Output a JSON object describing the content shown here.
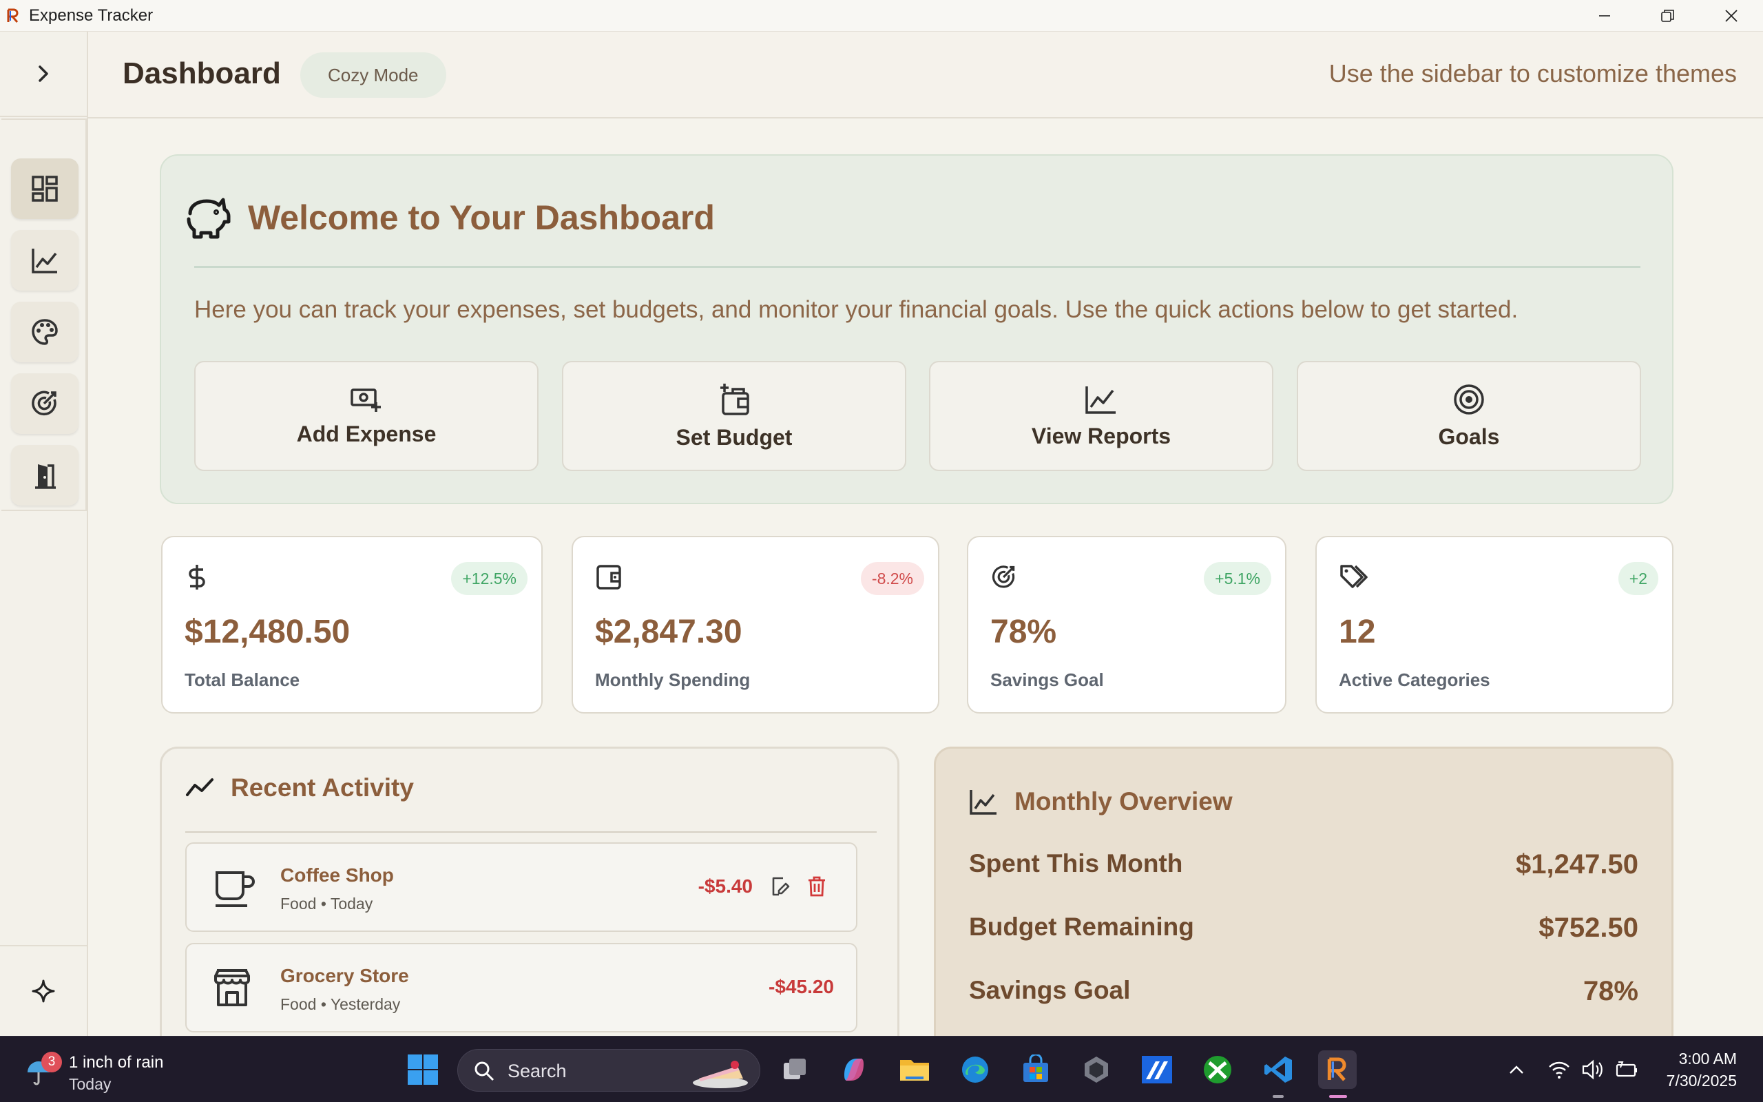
{
  "window": {
    "title": "Expense Tracker"
  },
  "header": {
    "title": "Dashboard",
    "mode_badge": "Cozy Mode",
    "hint": "Use the sidebar to customize themes"
  },
  "sidebar": {
    "items": [
      {
        "icon": "dashboard-icon",
        "active": true
      },
      {
        "icon": "chart-line-icon",
        "active": false
      },
      {
        "icon": "palette-icon",
        "active": false
      },
      {
        "icon": "target-icon",
        "active": false
      },
      {
        "icon": "door-exit-icon",
        "active": false
      }
    ],
    "bottom_icon": "sparkle-icon"
  },
  "welcome": {
    "title": "Welcome to Your Dashboard",
    "text": "Here you can track your expenses, set budgets, and monitor your financial goals. Use the quick actions below to get started.",
    "actions": [
      {
        "label": "Add Expense",
        "icon": "cash-plus-icon"
      },
      {
        "label": "Set Budget",
        "icon": "wallet-plus-icon"
      },
      {
        "label": "View Reports",
        "icon": "chart-line-icon"
      },
      {
        "label": "Goals",
        "icon": "target-icon"
      }
    ]
  },
  "stats": [
    {
      "value": "$12,480.50",
      "label": "Total Balance",
      "change": "+12.5%",
      "trend": "positive",
      "icon": "dollar-icon"
    },
    {
      "value": "$2,847.30",
      "label": "Monthly Spending",
      "change": "-8.2%",
      "trend": "negative",
      "icon": "wallet-icon"
    },
    {
      "value": "78%",
      "label": "Savings Goal",
      "change": "+5.1%",
      "trend": "positive",
      "icon": "target-icon"
    },
    {
      "value": "12",
      "label": "Active Categories",
      "change": "+2",
      "trend": "positive",
      "icon": "tags-icon"
    }
  ],
  "activity": {
    "title": "Recent Activity",
    "items": [
      {
        "name": "Coffee Shop",
        "meta": "Food • Today",
        "amount": "-$5.40",
        "icon": "coffee-cup-icon",
        "actions": true
      },
      {
        "name": "Grocery Store",
        "meta": "Food • Yesterday",
        "amount": "-$45.20",
        "icon": "store-icon",
        "actions": false
      }
    ]
  },
  "overview": {
    "title": "Monthly Overview",
    "rows": [
      {
        "label": "Spent This Month",
        "value": "$1,247.50"
      },
      {
        "label": "Budget Remaining",
        "value": "$752.50"
      },
      {
        "label": "Savings Goal",
        "value": "78%"
      }
    ]
  },
  "taskbar": {
    "weather_line1": "1 inch of rain",
    "weather_line2": "Today",
    "weather_badge": "3",
    "search_label": "Search",
    "time": "3:00 AM",
    "date": "7/30/2025"
  },
  "colors": {
    "accent_brown": "#8c5e3c",
    "positive": "#3fa564",
    "negative": "#c83a3a",
    "welcome_bg": "#e8ede4",
    "overview_bg": "#e9e0d1"
  }
}
